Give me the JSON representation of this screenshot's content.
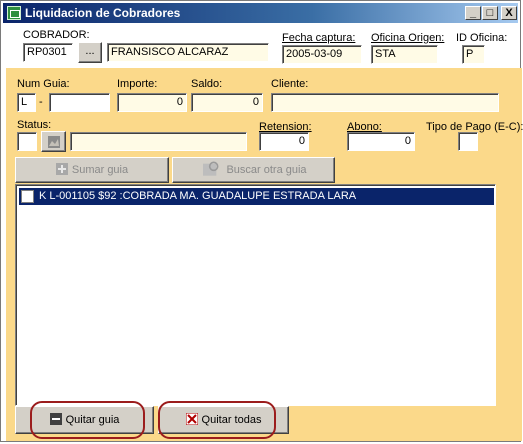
{
  "window": {
    "title": "Liquidacion de Cobradores",
    "controls": {
      "minimize": "_",
      "maximize": "□",
      "close": "X"
    }
  },
  "header": {
    "cobrador_label": "COBRADOR:",
    "cobrador_code": "RP0301",
    "lookup_button": "...",
    "cobrador_name": "FRANSISCO ALCARAZ",
    "fecha_label": "Fecha captura:",
    "fecha_value": "2005-03-09",
    "oficina_label": "Oficina Origen:",
    "oficina_value": "STA",
    "id_oficina_label": "ID Oficina:",
    "id_oficina_value": "P"
  },
  "form": {
    "num_guia_label": "Num Guia:",
    "num_guia_prefix": "L",
    "num_guia_dash": "-",
    "num_guia_value": "",
    "importe_label": "Importe:",
    "importe_value": "0",
    "saldo_label": "Saldo:",
    "saldo_value": "0",
    "cliente_label": "Cliente:",
    "cliente_value": "",
    "status_label": "Status:",
    "status_value": "",
    "status_desc": "",
    "retension_label": "Retension:",
    "retension_value": "0",
    "abono_label": "Abono:",
    "abono_value": "0",
    "tipo_pago_label": "Tipo de Pago (E-C):",
    "tipo_pago_value": ""
  },
  "actions": {
    "sumar_guia": "Sumar guia",
    "buscar_otra_guia": "Buscar otra guia",
    "quitar_guia": "Quitar guia",
    "quitar_todas": "Quitar todas"
  },
  "list": {
    "items": [
      {
        "text": "K L-001105 $92 :COBRADA  MA. GUADALUPE ESTRADA LARA",
        "selected": true
      }
    ]
  },
  "colors": {
    "panel": "#fbd98a",
    "titlebar": "#0a246a",
    "selection": "#0a246a",
    "highlight_oval": "#9b1c1c"
  }
}
